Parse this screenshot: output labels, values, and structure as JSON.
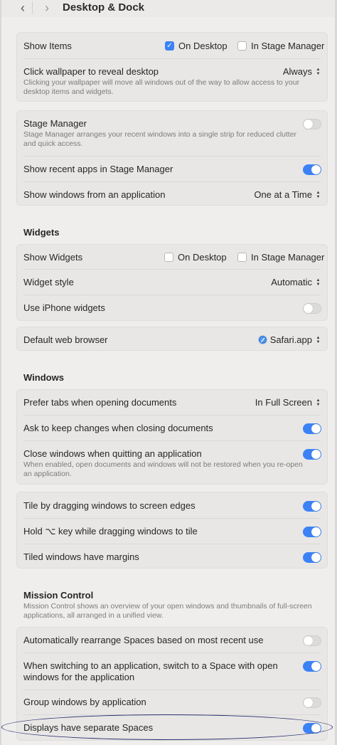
{
  "window": {
    "title": "Desktop & Dock",
    "back_icon": "‹",
    "forward_icon": "›"
  },
  "show_items": {
    "label": "Show Items",
    "on_desktop": {
      "label": "On Desktop",
      "checked": true
    },
    "in_stage_manager": {
      "label": "In Stage Manager",
      "checked": false
    }
  },
  "click_wallpaper": {
    "label": "Click wallpaper to reveal desktop",
    "value": "Always",
    "description": "Clicking your wallpaper will move all windows out of the way to allow access to your desktop items and widgets."
  },
  "stage_manager": {
    "label": "Stage Manager",
    "description": "Stage Manager arranges your recent windows into a single strip for reduced clutter and quick access.",
    "enabled": false
  },
  "recent_apps": {
    "label": "Show recent apps in Stage Manager",
    "enabled": true
  },
  "show_windows": {
    "label": "Show windows from an application",
    "value": "One at a Time"
  },
  "widgets": {
    "title": "Widgets",
    "show_widgets": {
      "label": "Show Widgets",
      "on_desktop": {
        "label": "On Desktop",
        "checked": false
      },
      "in_stage_manager": {
        "label": "In Stage Manager",
        "checked": false
      }
    },
    "style": {
      "label": "Widget style",
      "value": "Automatic"
    },
    "iphone": {
      "label": "Use iPhone widgets",
      "enabled": false
    }
  },
  "browser": {
    "label": "Default web browser",
    "value": "Safari.app"
  },
  "windows": {
    "title": "Windows",
    "prefer_tabs": {
      "label": "Prefer tabs when opening documents",
      "value": "In Full Screen"
    },
    "ask_keep": {
      "label": "Ask to keep changes when closing documents",
      "enabled": true
    },
    "close_windows": {
      "label": "Close windows when quitting an application",
      "description": "When enabled, open documents and windows will not be restored when you re-open an application.",
      "enabled": true
    },
    "tile_drag": {
      "label": "Tile by dragging windows to screen edges",
      "enabled": true
    },
    "hold_key": {
      "label": "Hold ⌥ key while dragging windows to tile",
      "enabled": true
    },
    "tiled_margins": {
      "label": "Tiled windows have margins",
      "enabled": true
    }
  },
  "mission_control": {
    "title": "Mission Control",
    "description": "Mission Control shows an overview of your open windows and thumbnails of full-screen applications, all arranged in a unified view.",
    "auto_rearrange": {
      "label": "Automatically rearrange Spaces based on most recent use",
      "enabled": false
    },
    "switch_space": {
      "label": "When switching to an application, switch to a Space with open windows for the application",
      "enabled": true
    },
    "group_windows": {
      "label": "Group windows by application",
      "enabled": false
    },
    "separate_spaces": {
      "label": "Displays have separate Spaces",
      "enabled": true
    }
  },
  "colors": {
    "accent": "#3c82f6",
    "toggle_off": "#dcdbda",
    "annotation": "#2c2f6e"
  }
}
